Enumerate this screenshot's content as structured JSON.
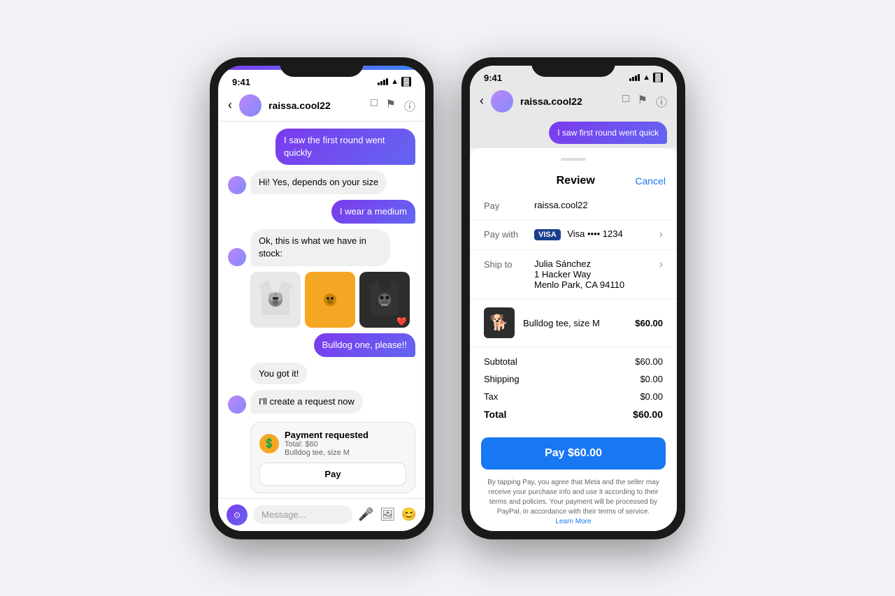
{
  "phone1": {
    "statusBar": {
      "time": "9:41",
      "icons": "signal wifi battery"
    },
    "navBar": {
      "username": "raissa.cool22"
    },
    "messages": [
      {
        "id": "m1",
        "type": "sent",
        "text": "I saw the first round went quickly"
      },
      {
        "id": "m2",
        "type": "received",
        "text": "Hi! Yes, depends on your size"
      },
      {
        "id": "m3",
        "type": "sent",
        "text": "I wear a medium"
      },
      {
        "id": "m4",
        "type": "received",
        "text": "Ok, this is what we have in stock:"
      },
      {
        "id": "m5",
        "type": "products"
      },
      {
        "id": "m6",
        "type": "sent",
        "text": "Bulldog one, please!!"
      },
      {
        "id": "m7",
        "type": "received-plain",
        "text": "You got it!"
      },
      {
        "id": "m8",
        "type": "received-create",
        "text": "I'll create a request now"
      },
      {
        "id": "m9",
        "type": "payment"
      }
    ],
    "payment": {
      "title": "Payment requested",
      "total": "Total: $60",
      "item": "Bulldog tee, size M",
      "payLabel": "Pay"
    },
    "inputBar": {
      "placeholder": "Message..."
    }
  },
  "phone2": {
    "statusBar": {
      "time": "9:41"
    },
    "navBar": {
      "username": "raissa.cool22"
    },
    "messages": [
      {
        "id": "m1",
        "type": "sent",
        "text": "I saw first round went quick"
      }
    ],
    "review": {
      "title": "Review",
      "cancelLabel": "Cancel",
      "payLabel": "Pay",
      "payRecipient": "raissa.cool22",
      "payWithLabel": "Pay with",
      "payWithCard": "Visa •••• 1234",
      "shipToLabel": "Ship to",
      "shipName": "Julia Sánchez",
      "shipAddress": "1 Hacker Way",
      "shipCity": "Menlo Park, CA 94110",
      "productName": "Bulldog tee, size M",
      "productPrice": "$60.00",
      "subtotalLabel": "Subtotal",
      "subtotalValue": "$60.00",
      "shippingLabel": "Shipping",
      "shippingValue": "$0.00",
      "taxLabel": "Tax",
      "taxValue": "$0.00",
      "totalLabel": "Total",
      "totalValue": "$60.00",
      "payButtonLabel": "Pay $60.00",
      "legalText": "By tapping Pay, you agree that Meta and the seller may receive your purchase info and use it according to their terms and policies. Your payment will be processed by PayPal, in accordance with their terms of service.",
      "learnMoreLabel": "Learn More"
    }
  }
}
